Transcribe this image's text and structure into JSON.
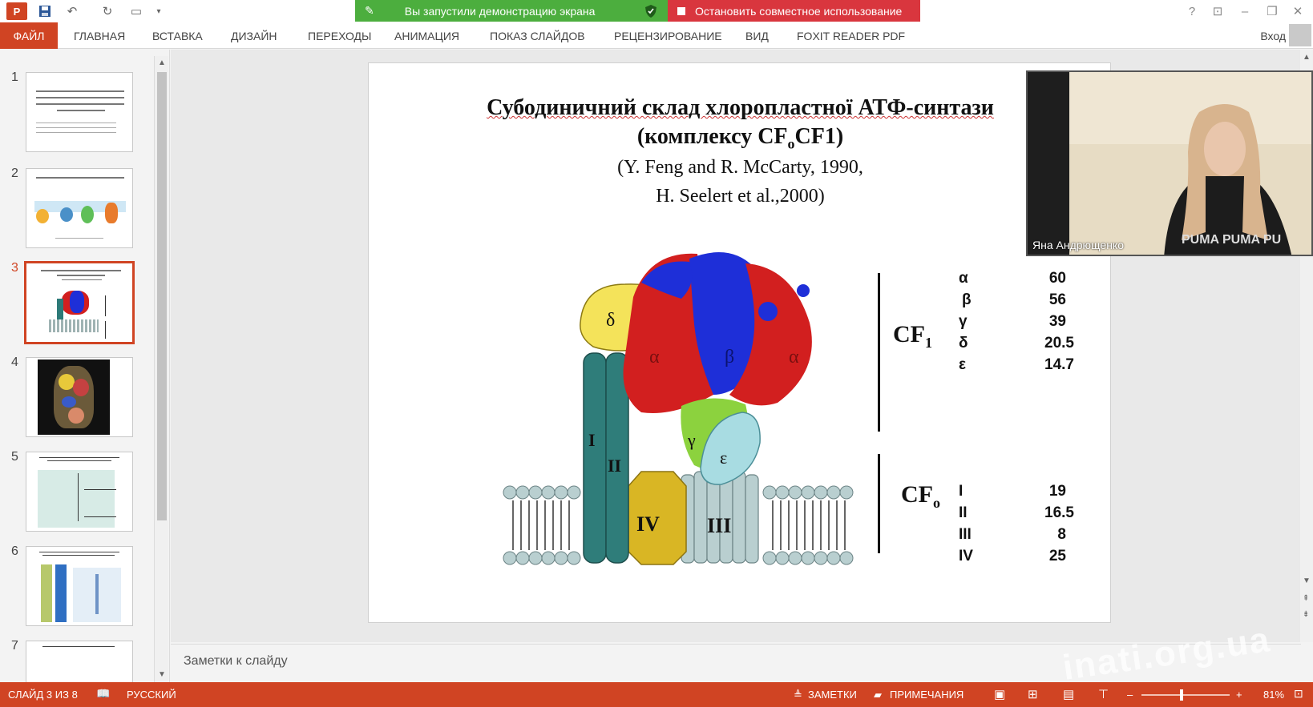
{
  "window": {
    "app_icon": "P",
    "share_banner": "Вы запустили демонстрацию экрана",
    "stop_sharing": "Остановить совместное использование",
    "help": "?",
    "sign_in": "Вход"
  },
  "ribbon": {
    "tabs": [
      "ФАЙЛ",
      "ГЛАВНАЯ",
      "ВСТАВКА",
      "ДИЗАЙН",
      "ПЕРЕХОДЫ",
      "АНИМАЦИЯ",
      "ПОКАЗ СЛАЙДОВ",
      "РЕЦЕНЗИРОВАНИЕ",
      "ВИД",
      "FOXIT READER PDF"
    ]
  },
  "thumbnails": {
    "numbers": [
      "1",
      "2",
      "3",
      "4",
      "5",
      "6",
      "7"
    ],
    "selected": 3
  },
  "slide": {
    "title_line1": "Субодиничний склад хлоропластної АТФ-синтази",
    "title_line2": "(комплексу CF",
    "title_sub": "o",
    "title_line2_end": "CF1)",
    "subtitle_line1": "(Y. Feng and R. McCarty, 1990,",
    "subtitle_line2": "H. Seelert et al.,2000)",
    "diagram_labels": {
      "delta": "δ",
      "alpha_left": "α",
      "beta": "β",
      "alpha_right": "α",
      "gamma": "γ",
      "epsilon": "ε",
      "sub_I": "I",
      "sub_II": "II",
      "sub_III": "III",
      "sub_IV": "IV"
    },
    "cf1_label": "CF",
    "cf1_sub": "1",
    "cfo_label": "CF",
    "cfo_sub": "o",
    "cf1_table": [
      {
        "subunit": "α",
        "mass": "60"
      },
      {
        "subunit": "β",
        "mass": "56"
      },
      {
        "subunit": "γ",
        "mass": "39"
      },
      {
        "subunit": "δ",
        "mass": "20.5"
      },
      {
        "subunit": "ε",
        "mass": "14.7"
      }
    ],
    "cfo_table": [
      {
        "subunit": "I",
        "mass": "19"
      },
      {
        "subunit": "II",
        "mass": "16.5"
      },
      {
        "subunit": "III",
        "mass": "8"
      },
      {
        "subunit": "IV",
        "mass": "25"
      }
    ]
  },
  "notes": {
    "placeholder": "Заметки к слайду"
  },
  "webcam": {
    "name": "Яна Андрющенко"
  },
  "statusbar": {
    "slide_counter": "СЛАЙД 3 ИЗ 8",
    "language": "РУССКИЙ",
    "notes_btn": "ЗАМЕТКИ",
    "comments_btn": "ПРИМЕЧАНИЯ",
    "zoom": "81%"
  },
  "watermark": "inati.org.ua"
}
